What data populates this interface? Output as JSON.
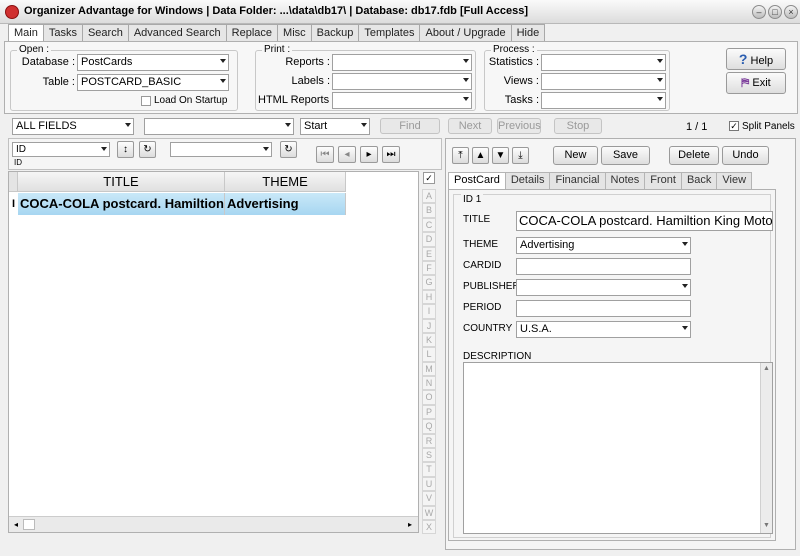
{
  "window": {
    "title": "Organizer Advantage for Windows | Data Folder: ...\\data\\db17\\ | Database: db17.fdb [Full Access]"
  },
  "tabs": [
    "Main",
    "Tasks",
    "Search",
    "Advanced Search",
    "Replace",
    "Misc",
    "Backup",
    "Templates",
    "About / Upgrade",
    "Hide"
  ],
  "open": {
    "legend": "Open :",
    "database_label": "Database :",
    "database_value": "PostCards",
    "table_label": "Table :",
    "table_value": "POSTCARD_BASIC",
    "load_on_startup": "Load On Startup"
  },
  "print": {
    "legend": "Print :",
    "reports_label": "Reports :",
    "labels_label": "Labels :",
    "html_label": "HTML Reports :"
  },
  "process": {
    "legend": "Process :",
    "statistics_label": "Statistics :",
    "views_label": "Views :",
    "tasks_label": "Tasks :"
  },
  "buttons": {
    "help": "Help",
    "exit": "Exit"
  },
  "searchbar": {
    "field": "ALL FIELDS",
    "mode": "Start",
    "find": "Find",
    "next": "Next",
    "previous": "Previous",
    "stop": "Stop",
    "count": "1 / 1",
    "split_panels": "Split Panels"
  },
  "sort": {
    "field": "ID",
    "sublabel": "ID"
  },
  "grid": {
    "columns": [
      "TITLE",
      "THEME"
    ],
    "rows": [
      {
        "marker": "I",
        "title": "COCA-COLA postcard. Hamiltion King Motor",
        "theme": "Advertising"
      }
    ]
  },
  "alphabet": [
    "A",
    "B",
    "C",
    "D",
    "E",
    "F",
    "G",
    "H",
    "I",
    "J",
    "K",
    "L",
    "M",
    "N",
    "O",
    "P",
    "Q",
    "R",
    "S",
    "T",
    "U",
    "V",
    "W",
    "X"
  ],
  "record_buttons": {
    "new": "New",
    "save": "Save",
    "delete": "Delete",
    "undo": "Undo"
  },
  "subtabs": [
    "PostCard",
    "Details",
    "Financial",
    "Notes",
    "Front",
    "Back",
    "View"
  ],
  "form": {
    "id_label": "ID 1",
    "title_label": "TITLE",
    "title_value": "COCA-COLA postcard. Hamiltion King Motor",
    "theme_label": "THEME",
    "theme_value": "Advertising",
    "cardid_label": "CARDID",
    "cardid_value": "",
    "publisher_label": "PUBLISHER",
    "publisher_value": "",
    "period_label": "PERIOD",
    "period_value": "",
    "country_label": "COUNTRY",
    "country_value": "U.S.A.",
    "description_label": "DESCRIPTION"
  }
}
